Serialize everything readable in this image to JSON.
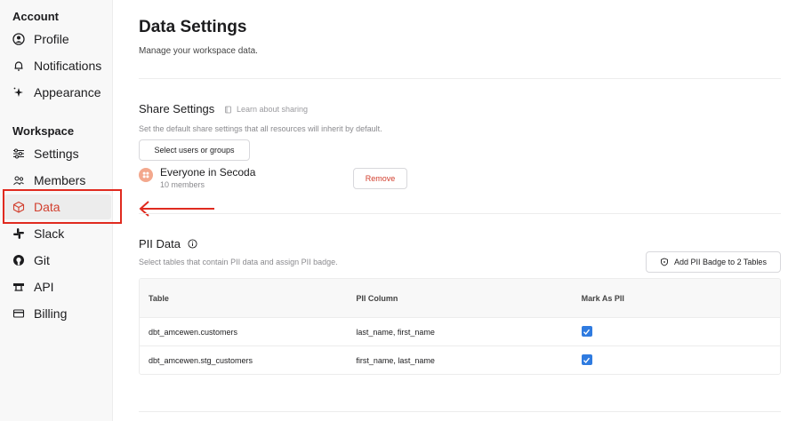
{
  "sidebar": {
    "account_label": "Account",
    "workspace_label": "Workspace",
    "account_items": [
      {
        "label": "Profile",
        "icon": "user-circle-icon"
      },
      {
        "label": "Notifications",
        "icon": "bell-icon"
      },
      {
        "label": "Appearance",
        "icon": "sparkle-icon"
      }
    ],
    "workspace_items": [
      {
        "label": "Settings",
        "icon": "sliders-icon"
      },
      {
        "label": "Members",
        "icon": "users-icon"
      },
      {
        "label": "Data",
        "icon": "cube-icon",
        "active": true
      },
      {
        "label": "Slack",
        "icon": "slack-icon"
      },
      {
        "label": "Git",
        "icon": "github-icon"
      },
      {
        "label": "API",
        "icon": "api-icon"
      },
      {
        "label": "Billing",
        "icon": "credit-card-icon"
      }
    ]
  },
  "page": {
    "title": "Data Settings",
    "subtitle": "Manage your workspace data."
  },
  "share": {
    "title": "Share Settings",
    "learn_link": "Learn about sharing",
    "description": "Set the default share settings that all resources will inherit by default.",
    "select_button": "Select users or groups",
    "member_name": "Everyone in Secoda",
    "member_count": "10 members",
    "remove_button": "Remove"
  },
  "pii": {
    "title": "PII Data",
    "description": "Select tables that contain PII data and assign PII badge.",
    "add_button": "Add PII Badge to 2 Tables",
    "columns": [
      "Table",
      "PII Column",
      "Mark As PII"
    ],
    "rows": [
      {
        "table": "dbt_amcewen.customers",
        "pii_column": "last_name, first_name",
        "mark": true
      },
      {
        "table": "dbt_amcewen.stg_customers",
        "pii_column": "first_name, last_name",
        "mark": true
      }
    ]
  },
  "colors": {
    "accent_red": "#e02a1f",
    "active_text": "#d23f2e",
    "checkbox_blue": "#2f7be0"
  }
}
